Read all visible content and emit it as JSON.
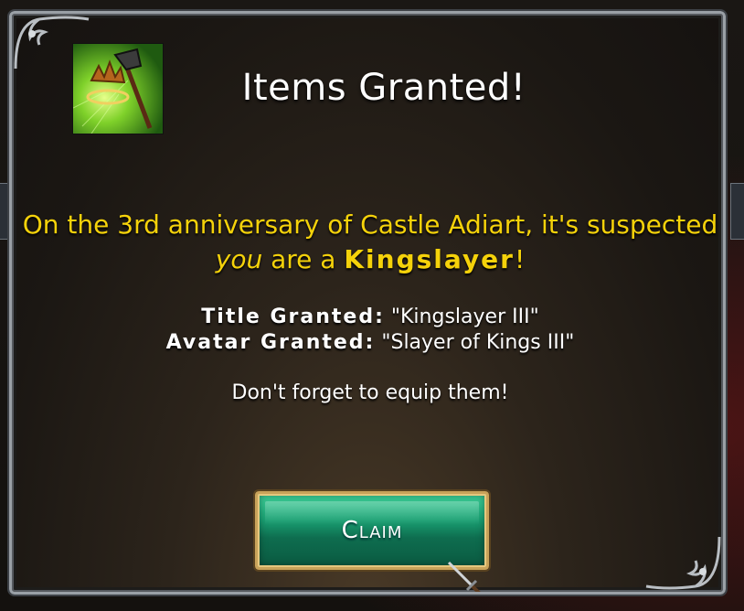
{
  "dialog": {
    "title": "Items Granted!",
    "message": {
      "part1": "On the 3rd anniversary of Castle Adiart, it's suspected ",
      "emphasis": "you",
      "part2": " are a ",
      "strong": "Kingslayer",
      "part3": "!"
    },
    "grants": [
      {
        "label": "Title Granted:",
        "value": "\"Kingslayer III\""
      },
      {
        "label": "Avatar Granted:",
        "value": "\"Slayer of Kings III\""
      }
    ],
    "reminder": "Don't forget to equip them!",
    "claim_label": "Claim"
  },
  "icons": {
    "item": "crown-and-axe-icon",
    "cursor": "sword-icon"
  },
  "colors": {
    "message": "#f5d20a",
    "button": "#1aa173",
    "border": "#9aa0a6"
  }
}
